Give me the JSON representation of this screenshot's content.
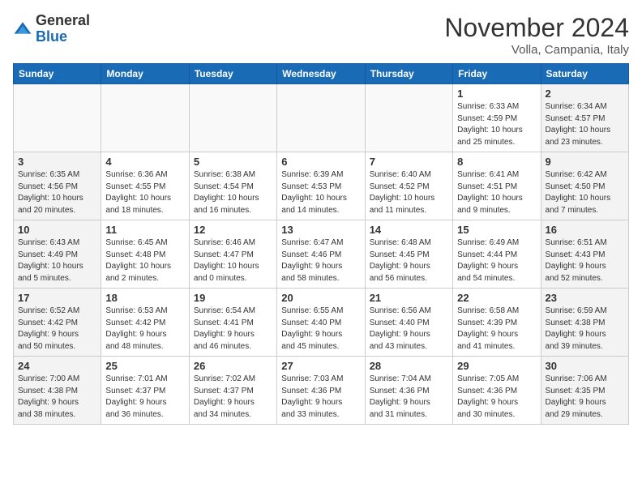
{
  "header": {
    "logo": {
      "general": "General",
      "blue": "Blue"
    },
    "title": "November 2024",
    "location": "Volla, Campania, Italy"
  },
  "weekdays": [
    "Sunday",
    "Monday",
    "Tuesday",
    "Wednesday",
    "Thursday",
    "Friday",
    "Saturday"
  ],
  "weeks": [
    [
      {
        "day": "",
        "info": ""
      },
      {
        "day": "",
        "info": ""
      },
      {
        "day": "",
        "info": ""
      },
      {
        "day": "",
        "info": ""
      },
      {
        "day": "",
        "info": ""
      },
      {
        "day": "1",
        "info": "Sunrise: 6:33 AM\nSunset: 4:59 PM\nDaylight: 10 hours\nand 25 minutes."
      },
      {
        "day": "2",
        "info": "Sunrise: 6:34 AM\nSunset: 4:57 PM\nDaylight: 10 hours\nand 23 minutes."
      }
    ],
    [
      {
        "day": "3",
        "info": "Sunrise: 6:35 AM\nSunset: 4:56 PM\nDaylight: 10 hours\nand 20 minutes."
      },
      {
        "day": "4",
        "info": "Sunrise: 6:36 AM\nSunset: 4:55 PM\nDaylight: 10 hours\nand 18 minutes."
      },
      {
        "day": "5",
        "info": "Sunrise: 6:38 AM\nSunset: 4:54 PM\nDaylight: 10 hours\nand 16 minutes."
      },
      {
        "day": "6",
        "info": "Sunrise: 6:39 AM\nSunset: 4:53 PM\nDaylight: 10 hours\nand 14 minutes."
      },
      {
        "day": "7",
        "info": "Sunrise: 6:40 AM\nSunset: 4:52 PM\nDaylight: 10 hours\nand 11 minutes."
      },
      {
        "day": "8",
        "info": "Sunrise: 6:41 AM\nSunset: 4:51 PM\nDaylight: 10 hours\nand 9 minutes."
      },
      {
        "day": "9",
        "info": "Sunrise: 6:42 AM\nSunset: 4:50 PM\nDaylight: 10 hours\nand 7 minutes."
      }
    ],
    [
      {
        "day": "10",
        "info": "Sunrise: 6:43 AM\nSunset: 4:49 PM\nDaylight: 10 hours\nand 5 minutes."
      },
      {
        "day": "11",
        "info": "Sunrise: 6:45 AM\nSunset: 4:48 PM\nDaylight: 10 hours\nand 2 minutes."
      },
      {
        "day": "12",
        "info": "Sunrise: 6:46 AM\nSunset: 4:47 PM\nDaylight: 10 hours\nand 0 minutes."
      },
      {
        "day": "13",
        "info": "Sunrise: 6:47 AM\nSunset: 4:46 PM\nDaylight: 9 hours\nand 58 minutes."
      },
      {
        "day": "14",
        "info": "Sunrise: 6:48 AM\nSunset: 4:45 PM\nDaylight: 9 hours\nand 56 minutes."
      },
      {
        "day": "15",
        "info": "Sunrise: 6:49 AM\nSunset: 4:44 PM\nDaylight: 9 hours\nand 54 minutes."
      },
      {
        "day": "16",
        "info": "Sunrise: 6:51 AM\nSunset: 4:43 PM\nDaylight: 9 hours\nand 52 minutes."
      }
    ],
    [
      {
        "day": "17",
        "info": "Sunrise: 6:52 AM\nSunset: 4:42 PM\nDaylight: 9 hours\nand 50 minutes."
      },
      {
        "day": "18",
        "info": "Sunrise: 6:53 AM\nSunset: 4:42 PM\nDaylight: 9 hours\nand 48 minutes."
      },
      {
        "day": "19",
        "info": "Sunrise: 6:54 AM\nSunset: 4:41 PM\nDaylight: 9 hours\nand 46 minutes."
      },
      {
        "day": "20",
        "info": "Sunrise: 6:55 AM\nSunset: 4:40 PM\nDaylight: 9 hours\nand 45 minutes."
      },
      {
        "day": "21",
        "info": "Sunrise: 6:56 AM\nSunset: 4:40 PM\nDaylight: 9 hours\nand 43 minutes."
      },
      {
        "day": "22",
        "info": "Sunrise: 6:58 AM\nSunset: 4:39 PM\nDaylight: 9 hours\nand 41 minutes."
      },
      {
        "day": "23",
        "info": "Sunrise: 6:59 AM\nSunset: 4:38 PM\nDaylight: 9 hours\nand 39 minutes."
      }
    ],
    [
      {
        "day": "24",
        "info": "Sunrise: 7:00 AM\nSunset: 4:38 PM\nDaylight: 9 hours\nand 38 minutes."
      },
      {
        "day": "25",
        "info": "Sunrise: 7:01 AM\nSunset: 4:37 PM\nDaylight: 9 hours\nand 36 minutes."
      },
      {
        "day": "26",
        "info": "Sunrise: 7:02 AM\nSunset: 4:37 PM\nDaylight: 9 hours\nand 34 minutes."
      },
      {
        "day": "27",
        "info": "Sunrise: 7:03 AM\nSunset: 4:36 PM\nDaylight: 9 hours\nand 33 minutes."
      },
      {
        "day": "28",
        "info": "Sunrise: 7:04 AM\nSunset: 4:36 PM\nDaylight: 9 hours\nand 31 minutes."
      },
      {
        "day": "29",
        "info": "Sunrise: 7:05 AM\nSunset: 4:36 PM\nDaylight: 9 hours\nand 30 minutes."
      },
      {
        "day": "30",
        "info": "Sunrise: 7:06 AM\nSunset: 4:35 PM\nDaylight: 9 hours\nand 29 minutes."
      }
    ]
  ]
}
